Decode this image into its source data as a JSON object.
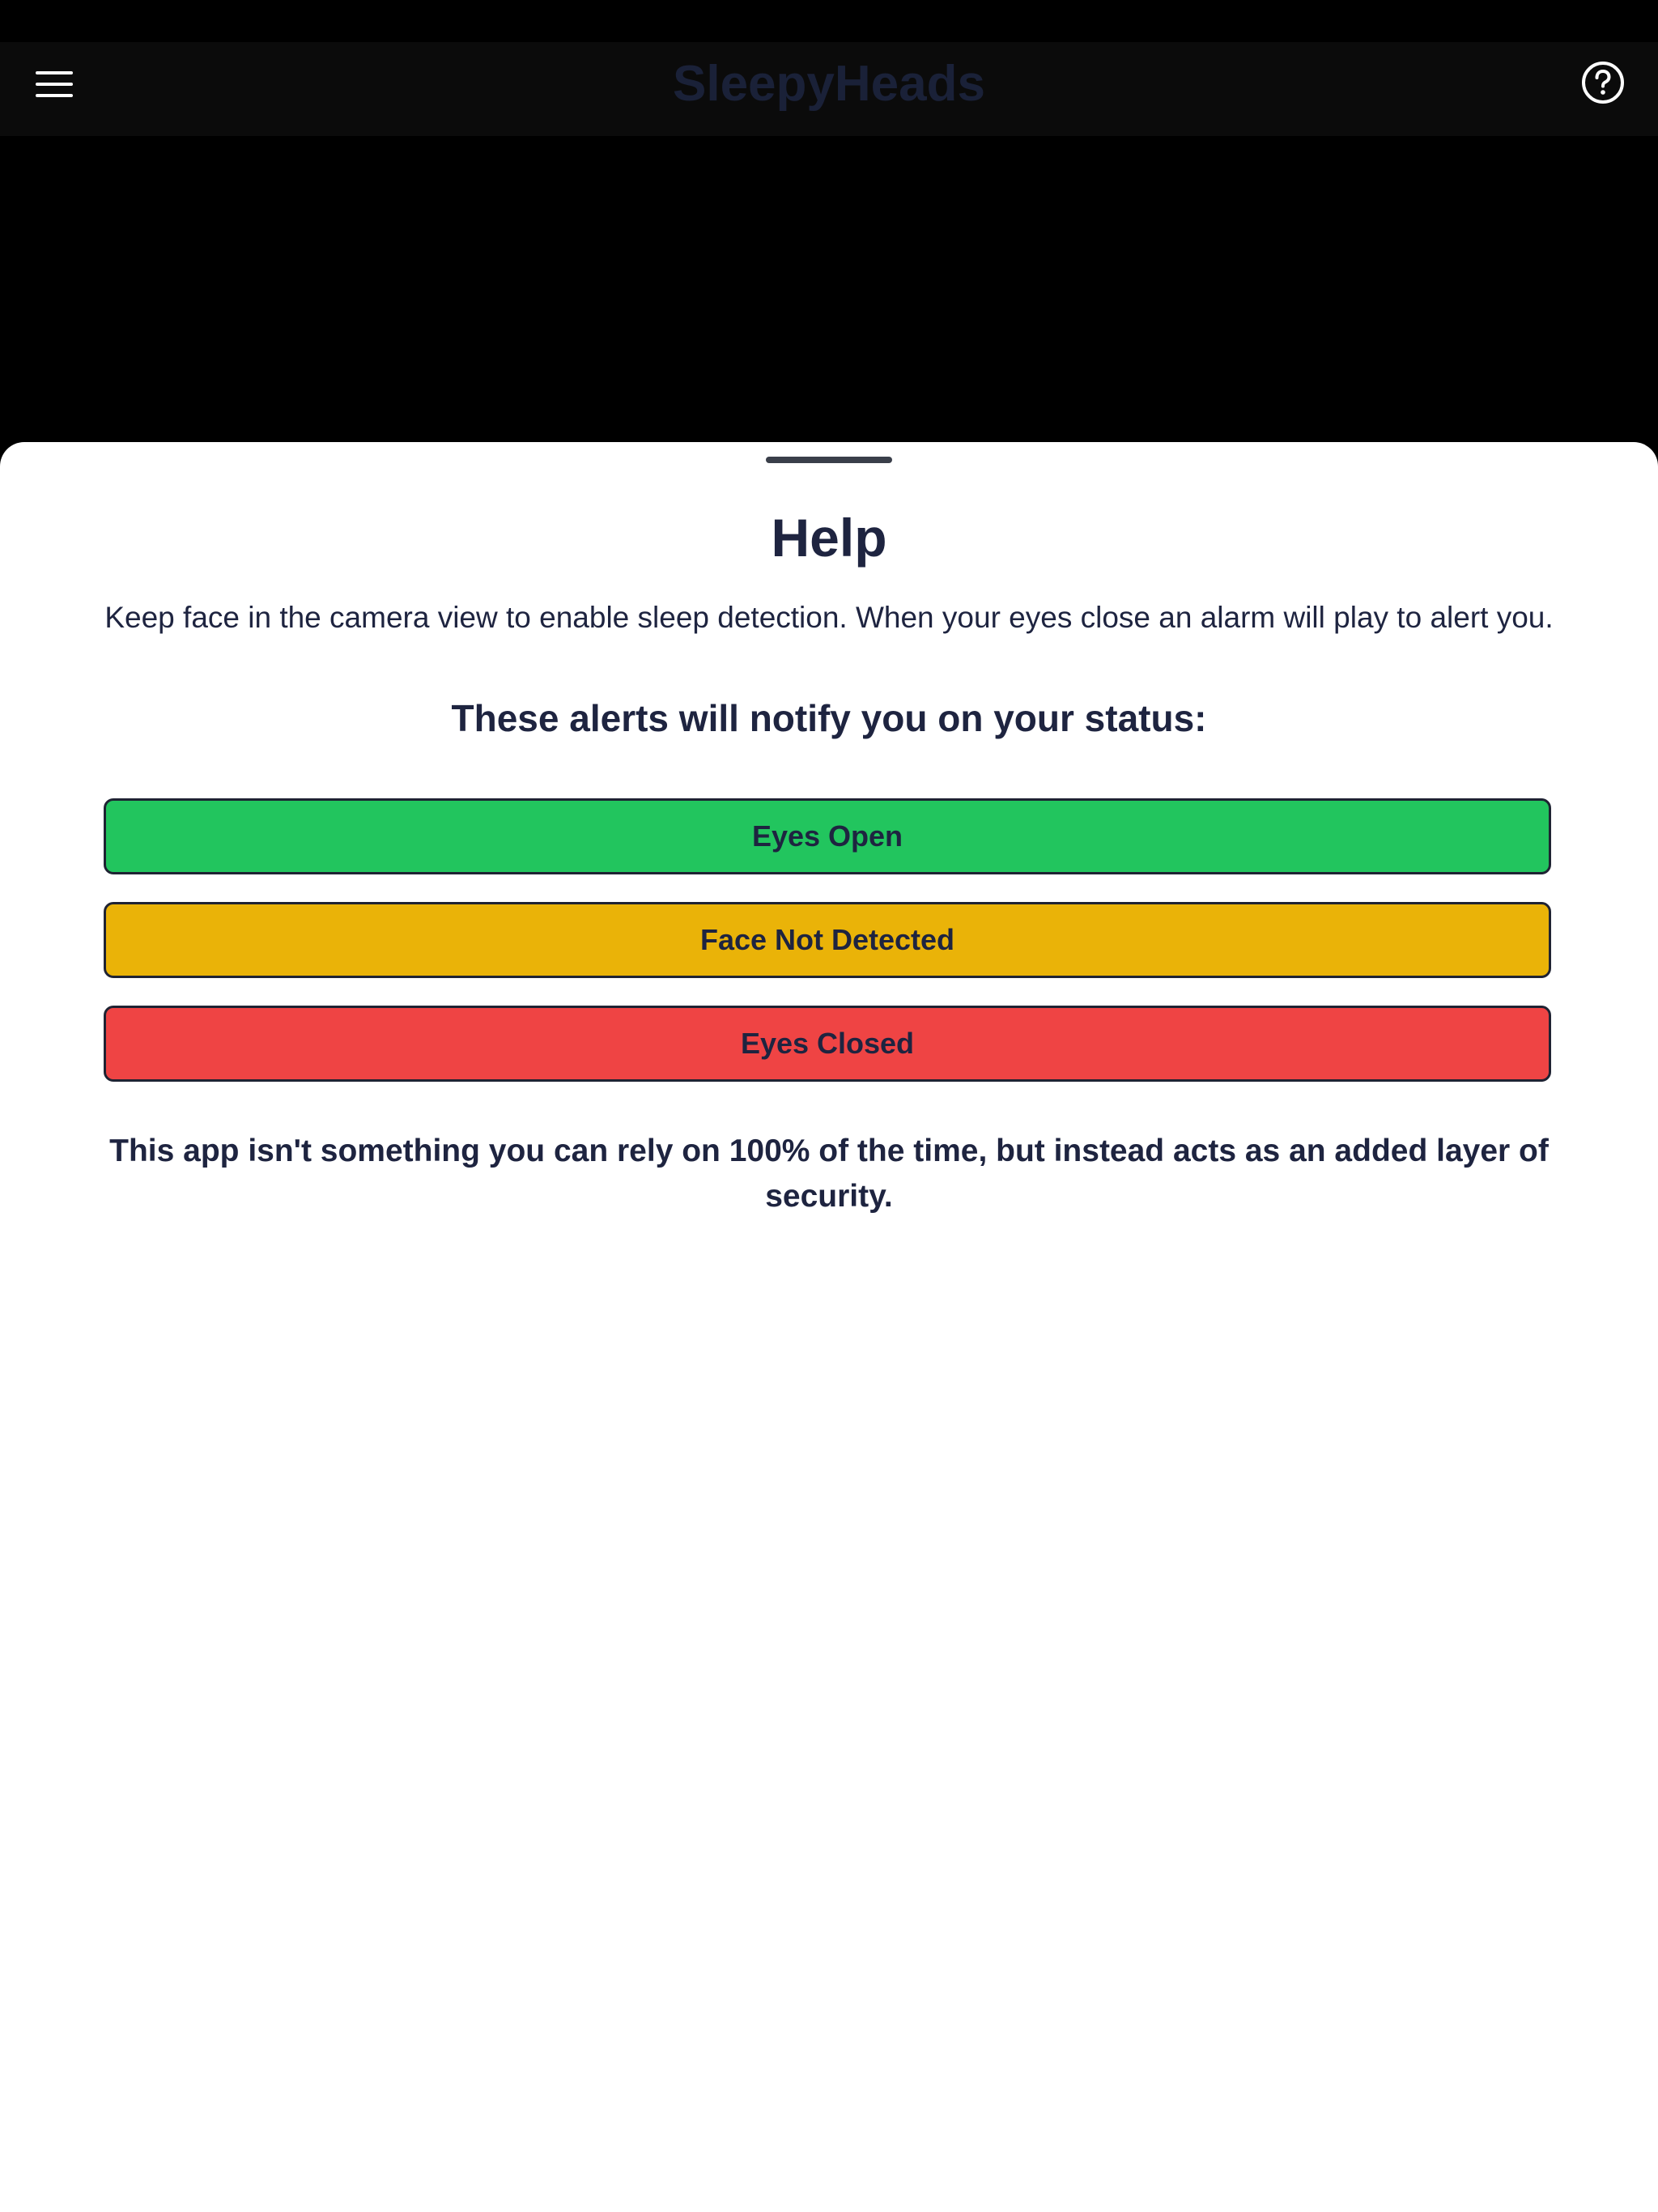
{
  "header": {
    "title": "SleepyHeads",
    "menu_icon": "hamburger-menu-icon",
    "help_icon": "question-circle-icon"
  },
  "help_sheet": {
    "title": "Help",
    "intro": "Keep face in the camera view to enable sleep detection. When your eyes close an alarm will play to alert you.",
    "subheading": "These alerts will notify you on your status:",
    "statuses": [
      {
        "label": "Eyes Open",
        "color": "#22c55e"
      },
      {
        "label": "Face Not Detected",
        "color": "#eab308"
      },
      {
        "label": "Eyes Closed",
        "color": "#ef4444"
      }
    ],
    "disclaimer": "This app isn't something you can rely on 100% of the time, but instead acts as an added layer of security."
  },
  "colors": {
    "background": "#000000",
    "header_bg": "#0b0b0b",
    "title_color": "#1a2138",
    "text_color": "#1e2440",
    "sheet_bg": "#ffffff"
  }
}
